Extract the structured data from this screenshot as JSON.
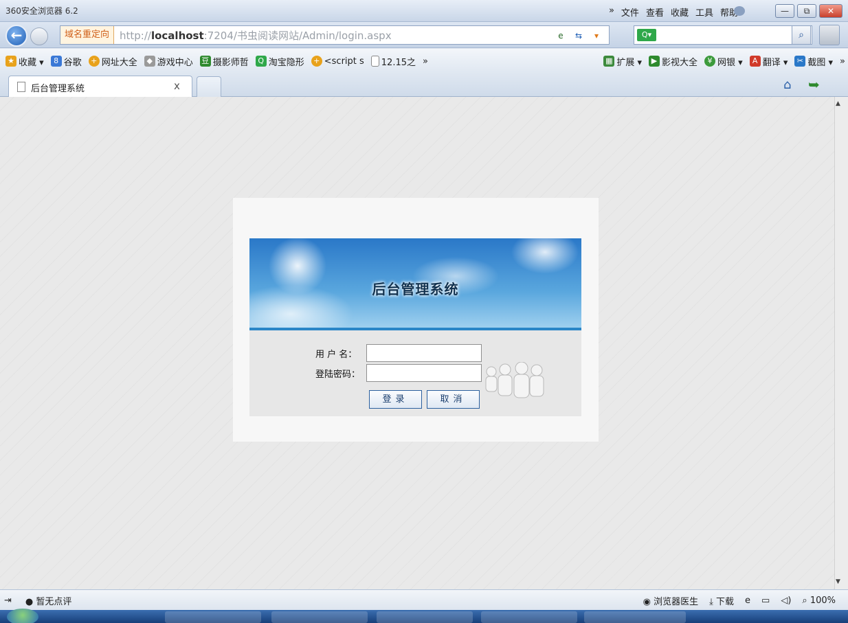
{
  "window": {
    "app_title": "360安全浏览器 6.2",
    "menu": [
      "»",
      "文件",
      "查看",
      "收藏",
      "工具",
      "帮助"
    ],
    "controls": {
      "minimize": "—",
      "restore": "⧉",
      "close": "✕"
    }
  },
  "address_bar": {
    "redirect_label": "域名重定向",
    "url_prefix": "http://",
    "url_host": "localhost",
    "url_rest": ":7204/书虫阅读网站/Admin/login.aspx",
    "search_placeholder": "",
    "search_engine_icon": "Q▾"
  },
  "favorites": [
    {
      "label": "收藏 ▾",
      "icon": "star-icon",
      "color": "#e8a21c"
    },
    {
      "label": "谷歌",
      "icon": "google-icon",
      "color": "#3a78d6"
    },
    {
      "label": "网址大全",
      "icon": "link-icon",
      "color": "#e8a21c"
    },
    {
      "label": "游戏中心",
      "icon": "gamepad-icon",
      "color": "#7a7a7a"
    },
    {
      "label": "摄影师哲",
      "icon": "douban-icon",
      "color": "#2e8a2e"
    },
    {
      "label": "淘宝隐形",
      "icon": "search-icon",
      "color": "#2fa84a"
    },
    {
      "label": "<script s",
      "icon": "link-icon",
      "color": "#e8a21c"
    },
    {
      "label": "12.15之",
      "icon": "doc-icon",
      "color": "#9a9a9a"
    },
    {
      "label": "»",
      "icon": "",
      "color": ""
    }
  ],
  "favorites_right": [
    {
      "label": "扩展 ▾",
      "icon": "extensions-icon",
      "color": "#3c8a3c"
    },
    {
      "label": "影视大全",
      "icon": "video-icon",
      "color": "#2e8a2e"
    },
    {
      "label": "网银 ▾",
      "icon": "bank-icon",
      "color": "#3c9a3c"
    },
    {
      "label": "翻译 ▾",
      "icon": "translate-icon",
      "color": "#d03a2a"
    },
    {
      "label": "截图 ▾",
      "icon": "screenshot-icon",
      "color": "#2a78c8"
    },
    {
      "label": "»",
      "icon": "",
      "color": ""
    }
  ],
  "tab": {
    "title": "后台管理系统",
    "close": "x"
  },
  "login": {
    "banner_title": "后台管理系统",
    "username_label": "用 户 名：",
    "password_label": "登陆密码：",
    "username_value": "",
    "password_value": "",
    "login_button": "登录",
    "cancel_button": "取消"
  },
  "status_bar": {
    "left_text": "暂无点评",
    "doctor": "浏览器医生",
    "download": "下载",
    "zoom": "100%"
  },
  "colors": {
    "banner_blue": "#2a78c8",
    "button_border": "#2b5f9e",
    "redirect_orange": "#d0601a"
  }
}
